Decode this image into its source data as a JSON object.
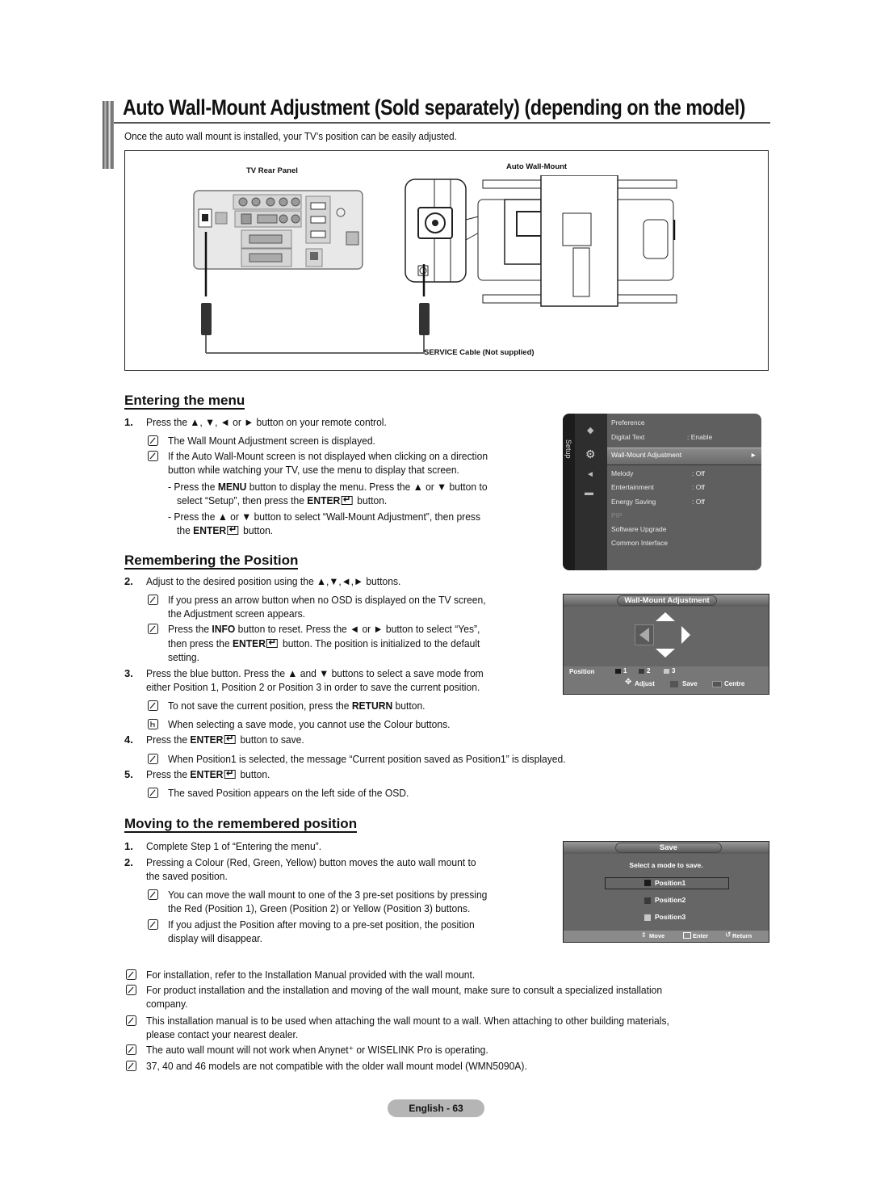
{
  "page": {
    "title": "Auto Wall-Mount Adjustment (Sold separately) (depending on the model)",
    "intro": "Once the auto wall mount is installed, your TV’s position can be easily adjusted.",
    "footer_page": "English - 63"
  },
  "figure": {
    "tv_rear_panel_label": "TV Rear Panel",
    "wall_mount_label": "Auto Wall-Mount",
    "cable_label": "SERVICE Cable  (Not supplied)",
    "port_label": "SERVICE"
  },
  "sections": {
    "entering": {
      "heading": "Entering the menu",
      "step1_num": "1.",
      "step1_pre": "Press the ▲, ▼, ◄ or ► button on your remote control.",
      "note1": "The Wall Mount Adjustment screen is displayed.",
      "note2_line1": "If the Auto Wall-Mount screen is not displayed when clicking on a direction",
      "note2_line2": "button while watching your TV, use the menu to display that screen.",
      "dash1_a": "- Press the ",
      "dash1_b": "MENU",
      "dash1_c": " button to display the menu. Press the ▲ or ▼ button to",
      "dash1_line2_a": "select “Setup”, then press the ",
      "dash1_line2_b": "ENTER",
      "dash1_line2_c": " button.",
      "dash2_line1": "- Press the ▲ or ▼ button to select “Wall-Mount Adjustment”, then press",
      "dash2_line2_a": "the ",
      "dash2_line2_b": "ENTER",
      "dash2_line2_c": " button."
    },
    "remembering": {
      "heading": "Remembering the Position",
      "step2_num": "2.",
      "step2": "Adjust to the desired position using the ▲,▼,◄,► buttons.",
      "note1_line1": "If you press an arrow button when no OSD is displayed on the TV screen,",
      "note1_line2": "the Adjustment screen appears.",
      "note2_line1_a": "Press the ",
      "note2_line1_b": "INFO",
      "note2_line1_c": " button to reset. Press the ◄ or ► button to select “Yes”,",
      "note2_line2_a": "then press the ",
      "note2_line2_b": "ENTER",
      "note2_line2_c": " button. The position is initialized to the default",
      "note2_line3": "setting.",
      "step3_num": "3.",
      "step3_line1": "Press the blue button. Press the ▲ and ▼ buttons to select a save mode from",
      "step3_line2": "either Position 1, Position 2 or Position 3 in order to save the current position.",
      "note3_a": "To not save the current position, press the ",
      "note3_b": "RETURN",
      "note3_c": " button.",
      "note4": "When selecting a save mode, you cannot use the Colour buttons.",
      "step4_num": "4.",
      "step4_a": "Press the ",
      "step4_b": "ENTER",
      "step4_c": " button to save.",
      "note5": "When Position1 is selected, the message “Current position saved as Position1” is displayed.",
      "step5_num": "5.",
      "step5_a": "Press the ",
      "step5_b": "ENTER",
      "step5_c": " button.",
      "note6": "The saved Position appears on the left side of the OSD."
    },
    "moving": {
      "heading": "Moving to the remembered position",
      "step1_num": "1.",
      "step1": "Complete Step 1 of “Entering the menu”.",
      "step2_num": "2.",
      "step2_line1": "Pressing a Colour (Red, Green, Yellow) button moves the auto wall mount to",
      "step2_line2": "the saved position.",
      "note1_line1": "You can move the wall mount to one of the 3 pre-set positions by pressing",
      "note1_line2": "the Red (Position 1), Green (Position 2) or Yellow (Position 3) buttons.",
      "note2_line1": "If you adjust the Position after moving to a pre-set position, the position",
      "note2_line2": "display will disappear."
    },
    "general_notes": [
      {
        "line1": "For installation, refer to the Installation Manual provided with the wall mount.",
        "line2": ""
      },
      {
        "line1": "For product installation and the installation and moving of the wall mount, make sure to consult a specialized installation",
        "line2": "company."
      },
      {
        "line1": "This installation manual is to be used when attaching the wall mount to a wall. When attaching to other building materials,",
        "line2": "please contact your nearest dealer."
      },
      {
        "line1": "The auto wall mount will not work when Anynet⁺ or WISELINK Pro is operating.",
        "line2": ""
      },
      {
        "line1": "37, 40 and 46 models are not compatible with the older wall mount model (WMN5090A).",
        "line2": ""
      }
    ]
  },
  "osd_setup": {
    "tab_label": "Setup",
    "items": [
      {
        "label": "Preference",
        "value": ""
      },
      {
        "label": "Digital Text",
        "value": ": Enable"
      },
      {
        "label": "Wall-Mount Adjustment",
        "value": "►"
      },
      {
        "label": "Melody",
        "value": ": Off"
      },
      {
        "label": "Entertainment",
        "value": ": Off"
      },
      {
        "label": "Energy Saving",
        "value": ": Off"
      },
      {
        "label": "PIP",
        "value": ""
      },
      {
        "label": "Software Upgrade",
        "value": ""
      },
      {
        "label": "Common Interface",
        "value": ""
      }
    ],
    "selected_index": 2
  },
  "osd_adjust": {
    "title": "Wall-Mount Adjustment",
    "position_label": "Position",
    "positions": [
      "1",
      "2",
      "3"
    ],
    "position_colors": [
      "#1a1a1a",
      "#3a3a3a",
      "#c8c8c8"
    ],
    "adjust_label": "Adjust",
    "save_label": "Save",
    "centre_label": "Centre"
  },
  "osd_save": {
    "title": "Save",
    "prompt": "Select a mode to save.",
    "options": [
      "Position1",
      "Position2",
      "Position3"
    ],
    "option_colors": [
      "#1a1a1a",
      "#3a3a3a",
      "#c8c8c8"
    ],
    "selected_index": 0,
    "move_label": "Move",
    "enter_label": "Enter",
    "return_label": "Return"
  }
}
